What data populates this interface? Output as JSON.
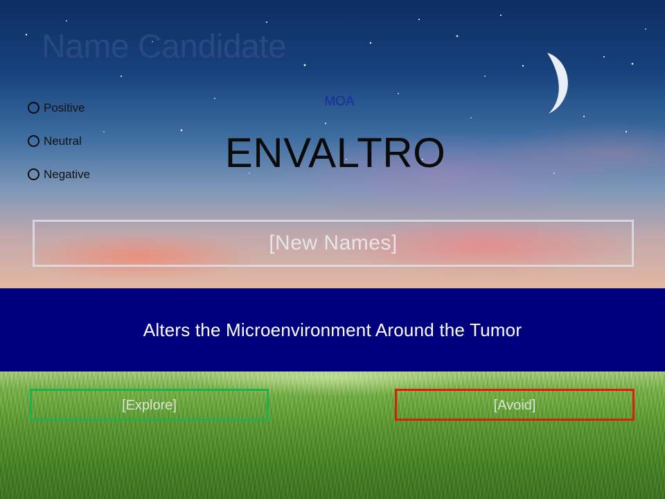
{
  "header": {
    "title": "Name Candidate"
  },
  "rating_options": [
    {
      "label": "Positive"
    },
    {
      "label": "Neutral"
    },
    {
      "label": "Negative"
    }
  ],
  "moa_label": "MOA",
  "candidate_name": "ENVALTRO",
  "new_names_placeholder": "[New Names]",
  "description": "Alters the Microenvironment Around the Tumor",
  "explore_label": "[Explore]",
  "avoid_label": "[Avoid]",
  "colors": {
    "band": "#00007f",
    "explore_border": "#22b04b",
    "avoid_border": "#e11a10",
    "moa_text": "#1a2aa8"
  },
  "icons": {
    "moon": "crescent-moon-icon",
    "radio": "radio-circle-icon"
  }
}
